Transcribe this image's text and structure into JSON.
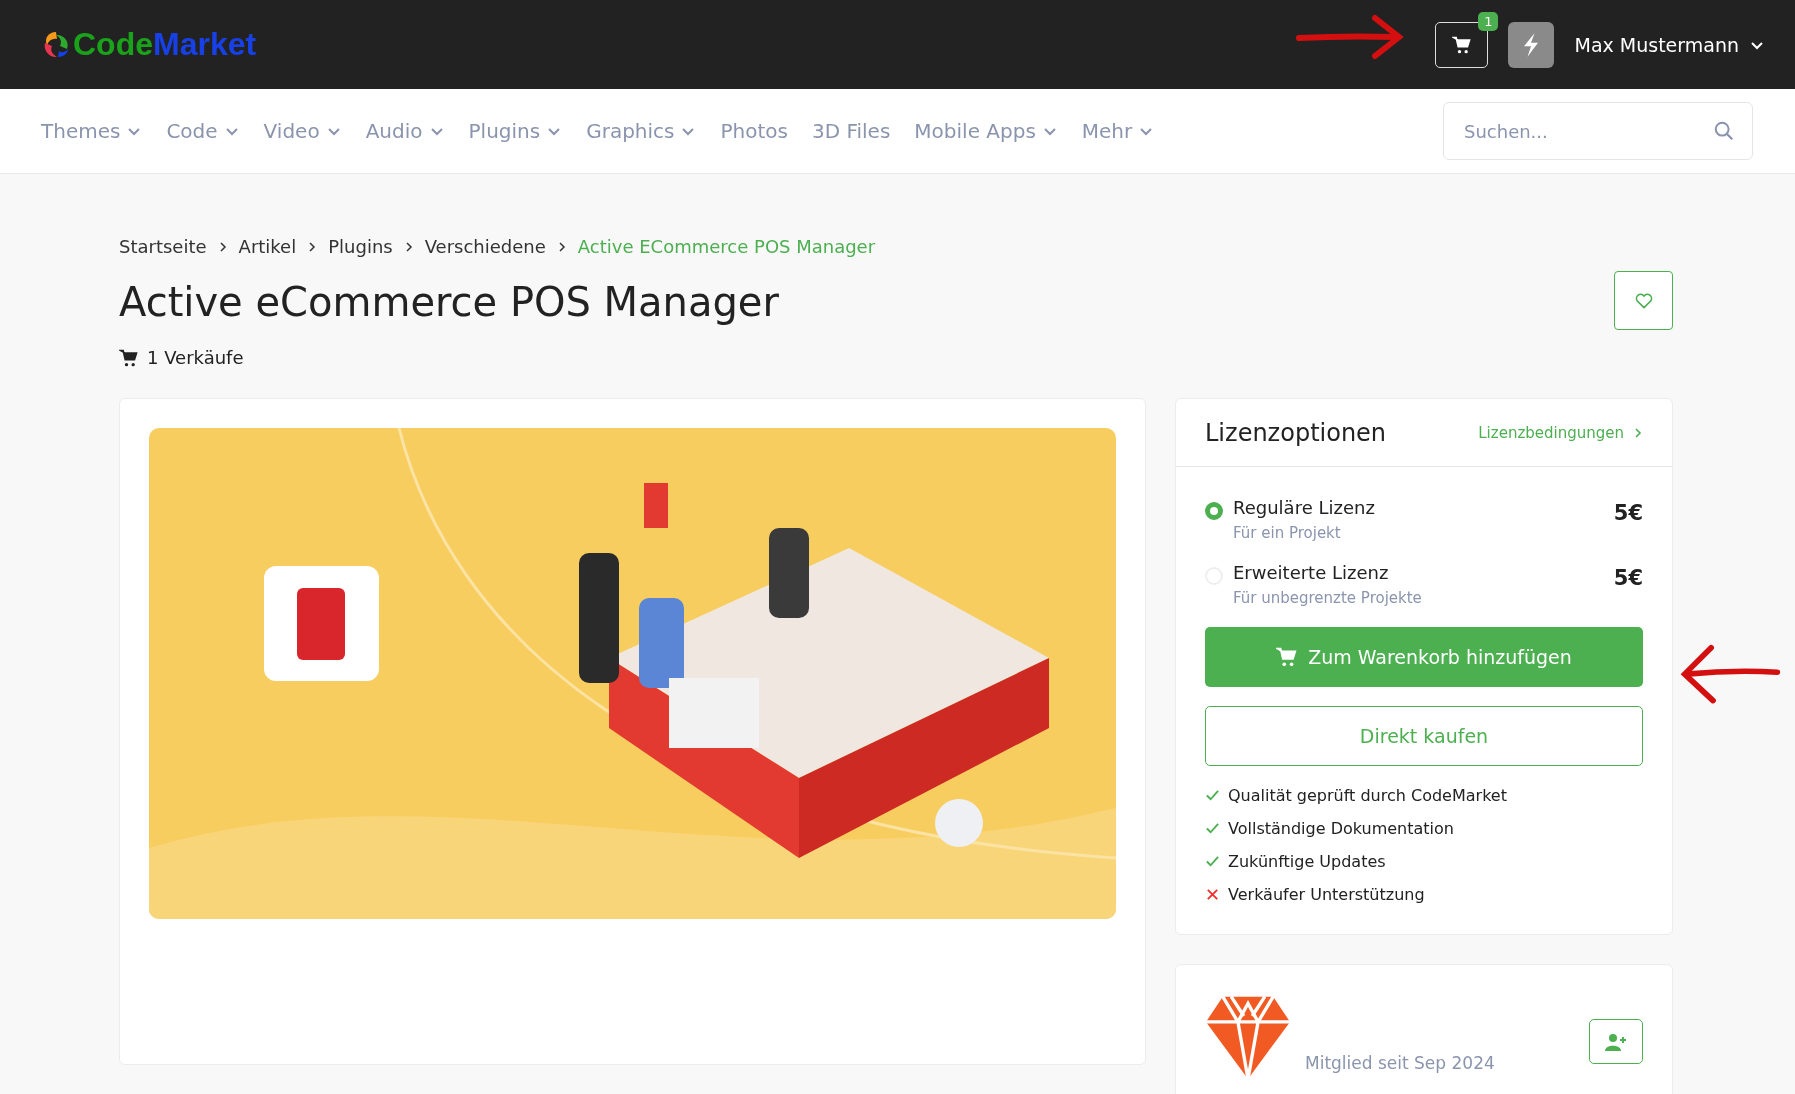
{
  "header": {
    "logo": [
      {
        "text": "Code",
        "color": "#1aa31a"
      },
      {
        "text": "Market",
        "color": "#1740e6"
      }
    ],
    "cart_count": "1",
    "user_name": "Max Mustermann"
  },
  "nav": [
    {
      "label": "Themes",
      "has_dropdown": true
    },
    {
      "label": "Code",
      "has_dropdown": true
    },
    {
      "label": "Video",
      "has_dropdown": true
    },
    {
      "label": "Audio",
      "has_dropdown": true
    },
    {
      "label": "Plugins",
      "has_dropdown": true
    },
    {
      "label": "Graphics",
      "has_dropdown": true
    },
    {
      "label": "Photos",
      "has_dropdown": false
    },
    {
      "label": "3D Files",
      "has_dropdown": false
    },
    {
      "label": "Mobile Apps",
      "has_dropdown": true
    },
    {
      "label": "Mehr",
      "has_dropdown": true
    }
  ],
  "search": {
    "placeholder": "Suchen..."
  },
  "breadcrumb": [
    {
      "label": "Startseite",
      "current": false
    },
    {
      "label": "Artikel",
      "current": false
    },
    {
      "label": "Plugins",
      "current": false
    },
    {
      "label": "Verschiedene",
      "current": false
    },
    {
      "label": "Active ECommerce POS Manager",
      "current": true
    }
  ],
  "product": {
    "title": "Active eCommerce POS Manager",
    "sales": "1 Verkäufe"
  },
  "license_panel": {
    "title": "Lizenzoptionen",
    "terms_link": "Lizenzbedingungen",
    "options": [
      {
        "name": "Reguläre Lizenz",
        "description": "Für ein Projekt",
        "price": "5€",
        "selected": true
      },
      {
        "name": "Erweiterte Lizenz",
        "description": "Für unbegrenzte Projekte",
        "price": "5€",
        "selected": false
      }
    ],
    "add_to_cart": "Zum Warenkorb hinzufügen",
    "buy_now": "Direkt kaufen",
    "features": [
      {
        "text": "Qualität geprüft durch CodeMarket",
        "included": true
      },
      {
        "text": "Vollständige Dokumentation",
        "included": true
      },
      {
        "text": "Zukünftige Updates",
        "included": true
      },
      {
        "text": "Verkäufer Unterstützung",
        "included": false
      }
    ]
  },
  "author": {
    "member_since": "Mitglied seit Sep 2024"
  }
}
